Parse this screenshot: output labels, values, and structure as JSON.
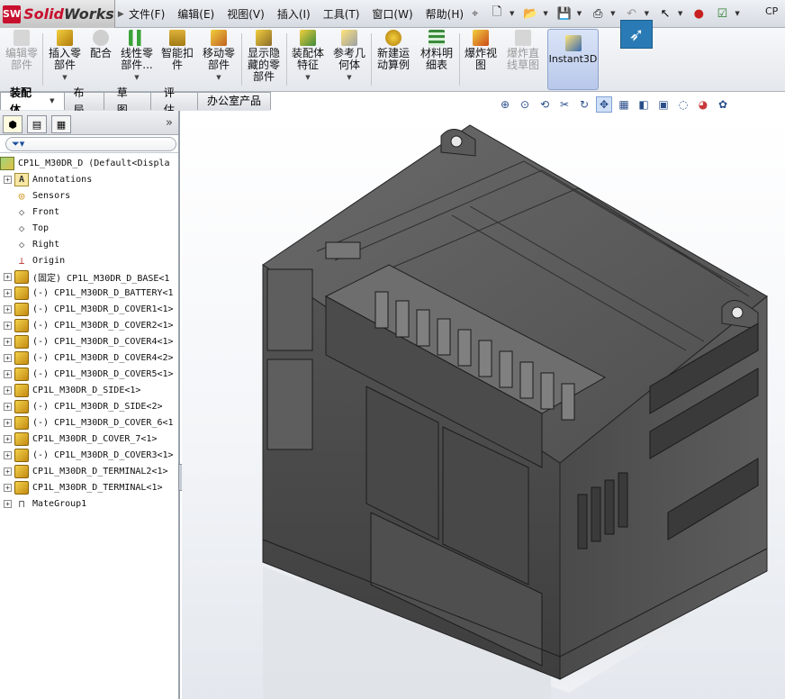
{
  "app": {
    "logo_prefix": "Solid",
    "logo_suffix": "Works",
    "logo_badge": "SW"
  },
  "menubar": [
    "文件(F)",
    "编辑(E)",
    "视图(V)",
    "插入(I)",
    "工具(T)",
    "窗口(W)",
    "帮助(H)"
  ],
  "title_fragment": "CP",
  "ribbon": {
    "buttons": [
      {
        "id": "edit-part",
        "label": "编辑零\n部件",
        "enabled": false
      },
      {
        "id": "insert-part",
        "label": "插入零\n部件",
        "enabled": true,
        "dropdown": true
      },
      {
        "id": "mate",
        "label": "配合",
        "enabled": true
      },
      {
        "id": "linear-pattern",
        "label": "线性零\n部件...",
        "enabled": true,
        "dropdown": true
      },
      {
        "id": "smart-fastener",
        "label": "智能扣\n件",
        "enabled": true
      },
      {
        "id": "move-component",
        "label": "移动零\n部件",
        "enabled": true,
        "dropdown": true
      },
      {
        "id": "show-hidden",
        "label": "显示隐\n藏的零\n部件",
        "enabled": true
      },
      {
        "id": "assembly-feature",
        "label": "装配体\n特征",
        "enabled": true,
        "dropdown": true
      },
      {
        "id": "reference-geometry",
        "label": "参考几\n何体",
        "enabled": true,
        "dropdown": true
      },
      {
        "id": "new-motion-study",
        "label": "新建运\n动算例",
        "enabled": true
      },
      {
        "id": "bom",
        "label": "材料明\n细表",
        "enabled": true
      },
      {
        "id": "exploded-view",
        "label": "爆炸视\n图",
        "enabled": true
      },
      {
        "id": "explode-line",
        "label": "爆炸直\n线草图",
        "enabled": false
      },
      {
        "id": "instant3d",
        "label": "Instant3D",
        "enabled": true,
        "active": true
      }
    ]
  },
  "tabs": [
    "装配体",
    "布局",
    "草图",
    "评估",
    "办公室产品"
  ],
  "active_tab": "装配体",
  "tree": {
    "root": {
      "label": "CP1L_M30DR_D  (Default<Displa"
    },
    "nodes": [
      {
        "label": "Annotations",
        "icon": "annotations-icon",
        "expandable": true
      },
      {
        "label": "Sensors",
        "icon": "sensor-icon",
        "expandable": false
      },
      {
        "label": "Front",
        "icon": "plane-icon",
        "expandable": false
      },
      {
        "label": "Top",
        "icon": "plane-icon",
        "expandable": false
      },
      {
        "label": "Right",
        "icon": "plane-icon",
        "expandable": false
      },
      {
        "label": "Origin",
        "icon": "origin-icon",
        "expandable": false
      },
      {
        "label": "(固定) CP1L_M30DR_D_BASE<1",
        "icon": "part-icon",
        "expandable": true
      },
      {
        "label": "(-) CP1L_M30DR_D_BATTERY<1",
        "icon": "part-icon",
        "expandable": true
      },
      {
        "label": "(-) CP1L_M30DR_D_COVER1<1>",
        "icon": "part-icon",
        "expandable": true
      },
      {
        "label": "(-) CP1L_M30DR_D_COVER2<1>",
        "icon": "part-icon",
        "expandable": true
      },
      {
        "label": "(-) CP1L_M30DR_D_COVER4<1>",
        "icon": "part-icon",
        "expandable": true
      },
      {
        "label": "(-) CP1L_M30DR_D_COVER4<2>",
        "icon": "part-icon",
        "expandable": true
      },
      {
        "label": "(-) CP1L_M30DR_D_COVER5<1>",
        "icon": "part-icon",
        "expandable": true
      },
      {
        "label": "CP1L_M30DR_D_SIDE<1>",
        "icon": "part-icon",
        "expandable": true
      },
      {
        "label": "(-) CP1L_M30DR_D_SIDE<2>",
        "icon": "part-icon",
        "expandable": true
      },
      {
        "label": "(-) CP1L_M30DR_D_COVER_6<1",
        "icon": "part-icon",
        "expandable": true
      },
      {
        "label": "CP1L_M30DR_D_COVER_7<1>",
        "icon": "part-icon",
        "expandable": true
      },
      {
        "label": "(-) CP1L_M30DR_D_COVER3<1>",
        "icon": "part-icon",
        "expandable": true
      },
      {
        "label": "CP1L_M30DR_D_TERMINAL2<1>",
        "icon": "part-icon",
        "expandable": true
      },
      {
        "label": "CP1L_M30DR_D_TERMINAL<1>",
        "icon": "part-icon",
        "expandable": true
      },
      {
        "label": "MateGroup1",
        "icon": "mate-group-icon",
        "expandable": true
      }
    ]
  },
  "colors": {
    "accent": "#c8102e",
    "model": "#5a5a5a",
    "panel_border": "#9aa1ab"
  }
}
